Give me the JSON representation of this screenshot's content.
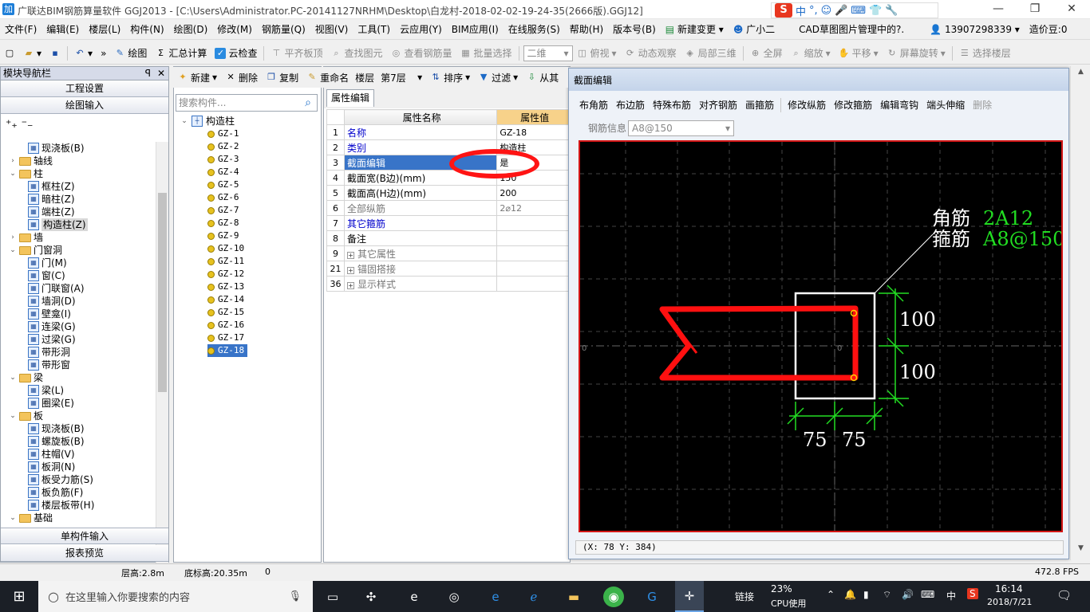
{
  "title_bar": {
    "title": "广联达BIM钢筋算量软件 GGJ2013 - [C:\\Users\\Administrator.PC-20141127NRHM\\Desktop\\白龙村-2018-02-02-19-24-35(2666版).GGJ12]",
    "app_icon": "加",
    "minimize": "—",
    "maximize": "❐",
    "close": "✕"
  },
  "ime_bar": {
    "logo": "S",
    "mode": "中",
    "punct": "°,",
    "items": [
      "☺",
      "🎤",
      "⌨",
      "👕",
      "🔧"
    ]
  },
  "menu": [
    "文件(F)",
    "编辑(E)",
    "楼层(L)",
    "构件(N)",
    "绘图(D)",
    "修改(M)",
    "钢筋量(Q)",
    "视图(V)",
    "工具(T)",
    "云应用(Y)",
    "BIM应用(I)",
    "在线服务(S)",
    "帮助(H)",
    "版本号(B)",
    "新建变更",
    "广小二",
    "CAD草图图片管理中的?.",
    "13907298339",
    "造价豆:0"
  ],
  "toolbar": {
    "draw": "绘图",
    "sum": "汇总计算",
    "cloud_check": "云检查",
    "align_top": "平齐板顶",
    "find": "查找图元",
    "view_rebar": "查看钢筋量",
    "batch": "批量选择",
    "view_mode": "二维",
    "top_view": "俯视",
    "dynamic": "动态观察",
    "local3d": "局部三维",
    "fullscreen": "全屏",
    "zoom": "缩放",
    "pan": "平移",
    "rotate": "屏幕旋转",
    "select_floor": "选择楼层"
  },
  "nav": {
    "title": "模块导航栏",
    "pin": "ꟼ",
    "close": "✕",
    "project_settings": "工程设置",
    "draw_input": "绘图输入",
    "single_input": "单构件输入",
    "report_preview": "报表预览",
    "tree": [
      {
        "label": "现浇板(B)",
        "type": "leaf",
        "level": 2,
        "icon": "slab-icon"
      },
      {
        "label": "轴线",
        "type": "folder",
        "level": 1,
        "exp": "›"
      },
      {
        "label": "柱",
        "type": "folder",
        "level": 1,
        "exp": "⌄"
      },
      {
        "label": "框柱(Z)",
        "type": "leaf",
        "level": 2,
        "icon": "column-icon"
      },
      {
        "label": "暗柱(Z)",
        "type": "leaf",
        "level": 2,
        "icon": "column-icon"
      },
      {
        "label": "端柱(Z)",
        "type": "leaf",
        "level": 2,
        "icon": "column-icon"
      },
      {
        "label": "构造柱(Z)",
        "type": "leaf",
        "level": 2,
        "icon": "column-icon",
        "selected": true
      },
      {
        "label": "墙",
        "type": "folder",
        "level": 1,
        "exp": "›"
      },
      {
        "label": "门窗洞",
        "type": "folder",
        "level": 1,
        "exp": "⌄"
      },
      {
        "label": "门(M)",
        "type": "leaf",
        "level": 2,
        "icon": "door-icon"
      },
      {
        "label": "窗(C)",
        "type": "leaf",
        "level": 2,
        "icon": "window-icon"
      },
      {
        "label": "门联窗(A)",
        "type": "leaf",
        "level": 2,
        "icon": "door-window-icon"
      },
      {
        "label": "墙洞(D)",
        "type": "leaf",
        "level": 2,
        "icon": "wall-hole-icon"
      },
      {
        "label": "壁龛(I)",
        "type": "leaf",
        "level": 2,
        "icon": "niche-icon"
      },
      {
        "label": "连梁(G)",
        "type": "leaf",
        "level": 2,
        "icon": "beam-icon"
      },
      {
        "label": "过梁(G)",
        "type": "leaf",
        "level": 2,
        "icon": "beam-icon"
      },
      {
        "label": "带形洞",
        "type": "leaf",
        "level": 2,
        "icon": "strip-hole-icon"
      },
      {
        "label": "带形窗",
        "type": "leaf",
        "level": 2,
        "icon": "strip-window-icon"
      },
      {
        "label": "梁",
        "type": "folder",
        "level": 1,
        "exp": "⌄"
      },
      {
        "label": "梁(L)",
        "type": "leaf",
        "level": 2,
        "icon": "beam-icon"
      },
      {
        "label": "圈梁(E)",
        "type": "leaf",
        "level": 2,
        "icon": "ring-beam-icon"
      },
      {
        "label": "板",
        "type": "folder",
        "level": 1,
        "exp": "⌄"
      },
      {
        "label": "现浇板(B)",
        "type": "leaf",
        "level": 2,
        "icon": "slab-icon"
      },
      {
        "label": "螺旋板(B)",
        "type": "leaf",
        "level": 2,
        "icon": "spiral-slab-icon"
      },
      {
        "label": "柱帽(V)",
        "type": "leaf",
        "level": 2,
        "icon": "column-cap-icon"
      },
      {
        "label": "板洞(N)",
        "type": "leaf",
        "level": 2,
        "icon": "slab-hole-icon"
      },
      {
        "label": "板受力筋(S)",
        "type": "leaf",
        "level": 2,
        "icon": "rebar-icon"
      },
      {
        "label": "板负筋(F)",
        "type": "leaf",
        "level": 2,
        "icon": "rebar-icon"
      },
      {
        "label": "楼层板带(H)",
        "type": "leaf",
        "level": 2,
        "icon": "slab-strip-icon"
      },
      {
        "label": "基础",
        "type": "folder",
        "level": 1,
        "exp": "⌄"
      }
    ]
  },
  "comp_toolbar": {
    "new": "新建",
    "delete": "删除",
    "copy": "复制",
    "rename": "重命名",
    "floor_label": "楼层",
    "floor": "第7层",
    "sort": "排序",
    "filter": "过滤",
    "from": "从其"
  },
  "comp_list": {
    "search_placeholder": "搜索构件...",
    "root": "构造柱",
    "items": [
      "GZ-1",
      "GZ-2",
      "GZ-3",
      "GZ-4",
      "GZ-5",
      "GZ-6",
      "GZ-7",
      "GZ-8",
      "GZ-9",
      "GZ-10",
      "GZ-11",
      "GZ-12",
      "GZ-13",
      "GZ-14",
      "GZ-15",
      "GZ-16",
      "GZ-17",
      "GZ-18"
    ],
    "selected": "GZ-18"
  },
  "properties": {
    "tab": "属性编辑",
    "col_name": "属性名称",
    "col_value": "属性值",
    "rows": [
      {
        "n": "1",
        "name": "名称",
        "value": "GZ-18",
        "style": "blue"
      },
      {
        "n": "2",
        "name": "类别",
        "value": "构造柱",
        "style": "blue"
      },
      {
        "n": "3",
        "name": "截面编辑",
        "value": "是",
        "style": "selected"
      },
      {
        "n": "4",
        "name": "截面宽(B边)(mm)",
        "value": "150",
        "style": ""
      },
      {
        "n": "5",
        "name": "截面高(H边)(mm)",
        "value": "200",
        "style": ""
      },
      {
        "n": "6",
        "name": "全部纵筋",
        "value": "2⌀12",
        "style": "gray"
      },
      {
        "n": "7",
        "name": "其它箍筋",
        "value": "",
        "style": "blue"
      },
      {
        "n": "8",
        "name": "备注",
        "value": "",
        "style": ""
      },
      {
        "n": "9",
        "name": "其它属性",
        "value": "",
        "style": "group"
      },
      {
        "n": "21",
        "name": "锚固搭接",
        "value": "",
        "style": "group"
      },
      {
        "n": "36",
        "name": "显示样式",
        "value": "",
        "style": "group"
      }
    ]
  },
  "section_dialog": {
    "title": "截面编辑",
    "tools": [
      "布角筋",
      "布边筋",
      "特殊布筋",
      "对齐钢筋",
      "画箍筋",
      "修改纵筋",
      "修改箍筋",
      "编辑弯钩",
      "端头伸缩",
      "删除"
    ],
    "rebar_info_label": "钢筋信息",
    "rebar_info_value": "A8@150",
    "corner_label": "角筋",
    "corner_value": "2A12",
    "stirrup_label": "箍筋",
    "stirrup_value": "A8@150",
    "dim_h1": "100",
    "dim_h2": "100",
    "dim_w1": "75",
    "dim_w2": "75",
    "axis_zero_left": "0",
    "axis_zero_center": "0",
    "coord_readout": "(X: 78 Y: 384)"
  },
  "status_bar": {
    "floor_height": "层高:2.8m",
    "base_elev": "底标高:20.35m",
    "count": "0",
    "fps": "472.8 FPS"
  },
  "taskbar": {
    "search_placeholder": "在这里输入你要搜索的内容",
    "link": "链接",
    "cpu_pct": "23%",
    "cpu_label": "CPU使用",
    "lang": "中",
    "time": "16:14",
    "date": "2018/7/21"
  },
  "colors": {
    "accent": "#3874c8",
    "red_mark": "#ff1414",
    "dim_green": "#22dd22",
    "rebar_red": "#ff1010"
  }
}
